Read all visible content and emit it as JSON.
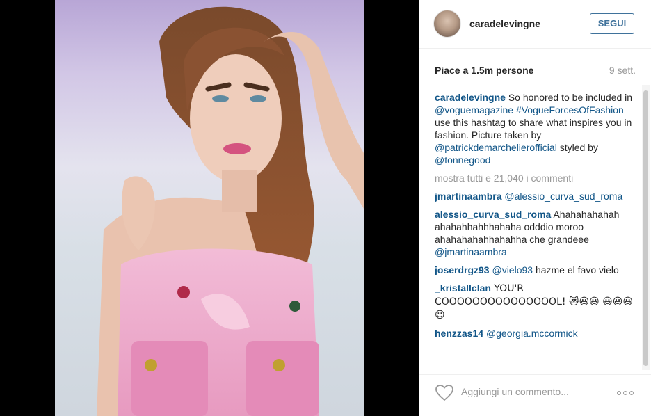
{
  "post": {
    "username": "caradelevingne",
    "follow_label": "SEGUI",
    "likes": "Piace a 1.5m persone",
    "age": "9 sett."
  },
  "caption": {
    "user": "caradelevingne",
    "text_1": " So honored to be included in ",
    "mention_1": "@voguemagazine",
    "text_2": " ",
    "hashtag": "#VogueForcesOfFashion",
    "text_3": " use this hashtag to share what inspires you in fashion. Picture taken by ",
    "mention_2": "@patrickdemarchelierofficial",
    "text_4": " styled by ",
    "mention_3": "@tonnegood"
  },
  "view_all": "mostra tutti e 21,040 i commenti",
  "comments": [
    {
      "user": "jmartinaambra",
      "mention": "@alessio_curva_sud_roma",
      "text": ""
    },
    {
      "user": "alessio_curva_sud_roma",
      "text": " Ahahahahahah ahahahhahhhahaha odddio moroo ahahahahahhahahha che grandeee ",
      "mention": "@jmartinaambra"
    },
    {
      "user": "joserdrgz93",
      "mention": "@vielo93",
      "text": " hazme el favo vielo"
    },
    {
      "user": "_kristallclan",
      "text": " YOU'R COOOOOOOOOOOOOOOL! 😻😃😃 😃😃😃☺"
    },
    {
      "user": "henzzas14",
      "mention": "@georgia.mccormick",
      "text": ""
    }
  ],
  "footer": {
    "input_placeholder": "Aggiungi un commento...",
    "heart_icon": "heart-outline-icon",
    "more_icon": "more-options-icon"
  },
  "colors": {
    "link": "#125688",
    "follow": "#3f729b",
    "muted": "#999999",
    "text": "#262626"
  }
}
